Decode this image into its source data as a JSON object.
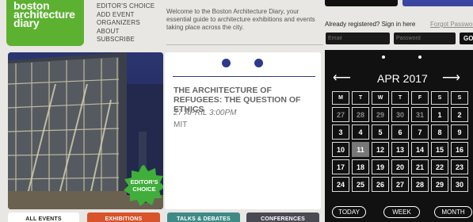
{
  "logo": {
    "lines": [
      "boston",
      "architecture",
      "diary"
    ]
  },
  "nav": {
    "items": [
      "EDITOR'S CHOICE",
      "ADD EVENT",
      "ORGANIZERS",
      "ABOUT",
      "SUBSCRIBE"
    ]
  },
  "welcome": {
    "text": "Welcome to the Boston Architecture Diary, your essential guide to architecture exhibitions and events taking place across the city."
  },
  "login": {
    "label": "Already registered? Sign in here",
    "forgot": "Forgot Password",
    "email_placeholder": "Email",
    "password_placeholder": "Password",
    "go_label": "GO"
  },
  "feature": {
    "badge": [
      "EDITOR'S",
      "CHOICE"
    ],
    "title": "THE ARCHITECTURE OF REFUGEES: THE QUESTION OF ETHICS",
    "date": "27 APRIL 3:00PM",
    "venue": "MIT"
  },
  "calendar": {
    "month": "APR 2017",
    "prev_arrow": "⟵",
    "next_arrow": "⟶",
    "weekdays": [
      "M",
      "T",
      "W",
      "T",
      "F",
      "S",
      "S"
    ],
    "weeks": [
      [
        "27",
        "28",
        "29",
        "30",
        "31",
        "1",
        "2"
      ],
      [
        "3",
        "4",
        "5",
        "6",
        "7",
        "8",
        "9"
      ],
      [
        "10",
        "11",
        "12",
        "13",
        "14",
        "15",
        "16"
      ],
      [
        "17",
        "18",
        "19",
        "20",
        "21",
        "22",
        "23"
      ],
      [
        "24",
        "25",
        "26",
        "27",
        "28",
        "29",
        "30"
      ]
    ],
    "today": "11",
    "buttons": [
      "TODAY",
      "WEEK",
      "MONTH"
    ]
  },
  "tabs": [
    {
      "label": "ALL EVENTS",
      "bg": "#ffffff",
      "fg": "#222222"
    },
    {
      "label": "EXHIBITIONS",
      "bg": "#d9532b",
      "fg": "#ffffff"
    },
    {
      "label": "TALKS & DEBATES",
      "bg": "#3f8a86",
      "fg": "#ffffff"
    },
    {
      "label": "CONFERENCES",
      "bg": "#4a4a52",
      "fg": "#ffffff"
    }
  ],
  "colors": {
    "brand_green": "#5cb130",
    "accent_blue": "#2c3a8c",
    "calendar_bg": "#111111"
  }
}
